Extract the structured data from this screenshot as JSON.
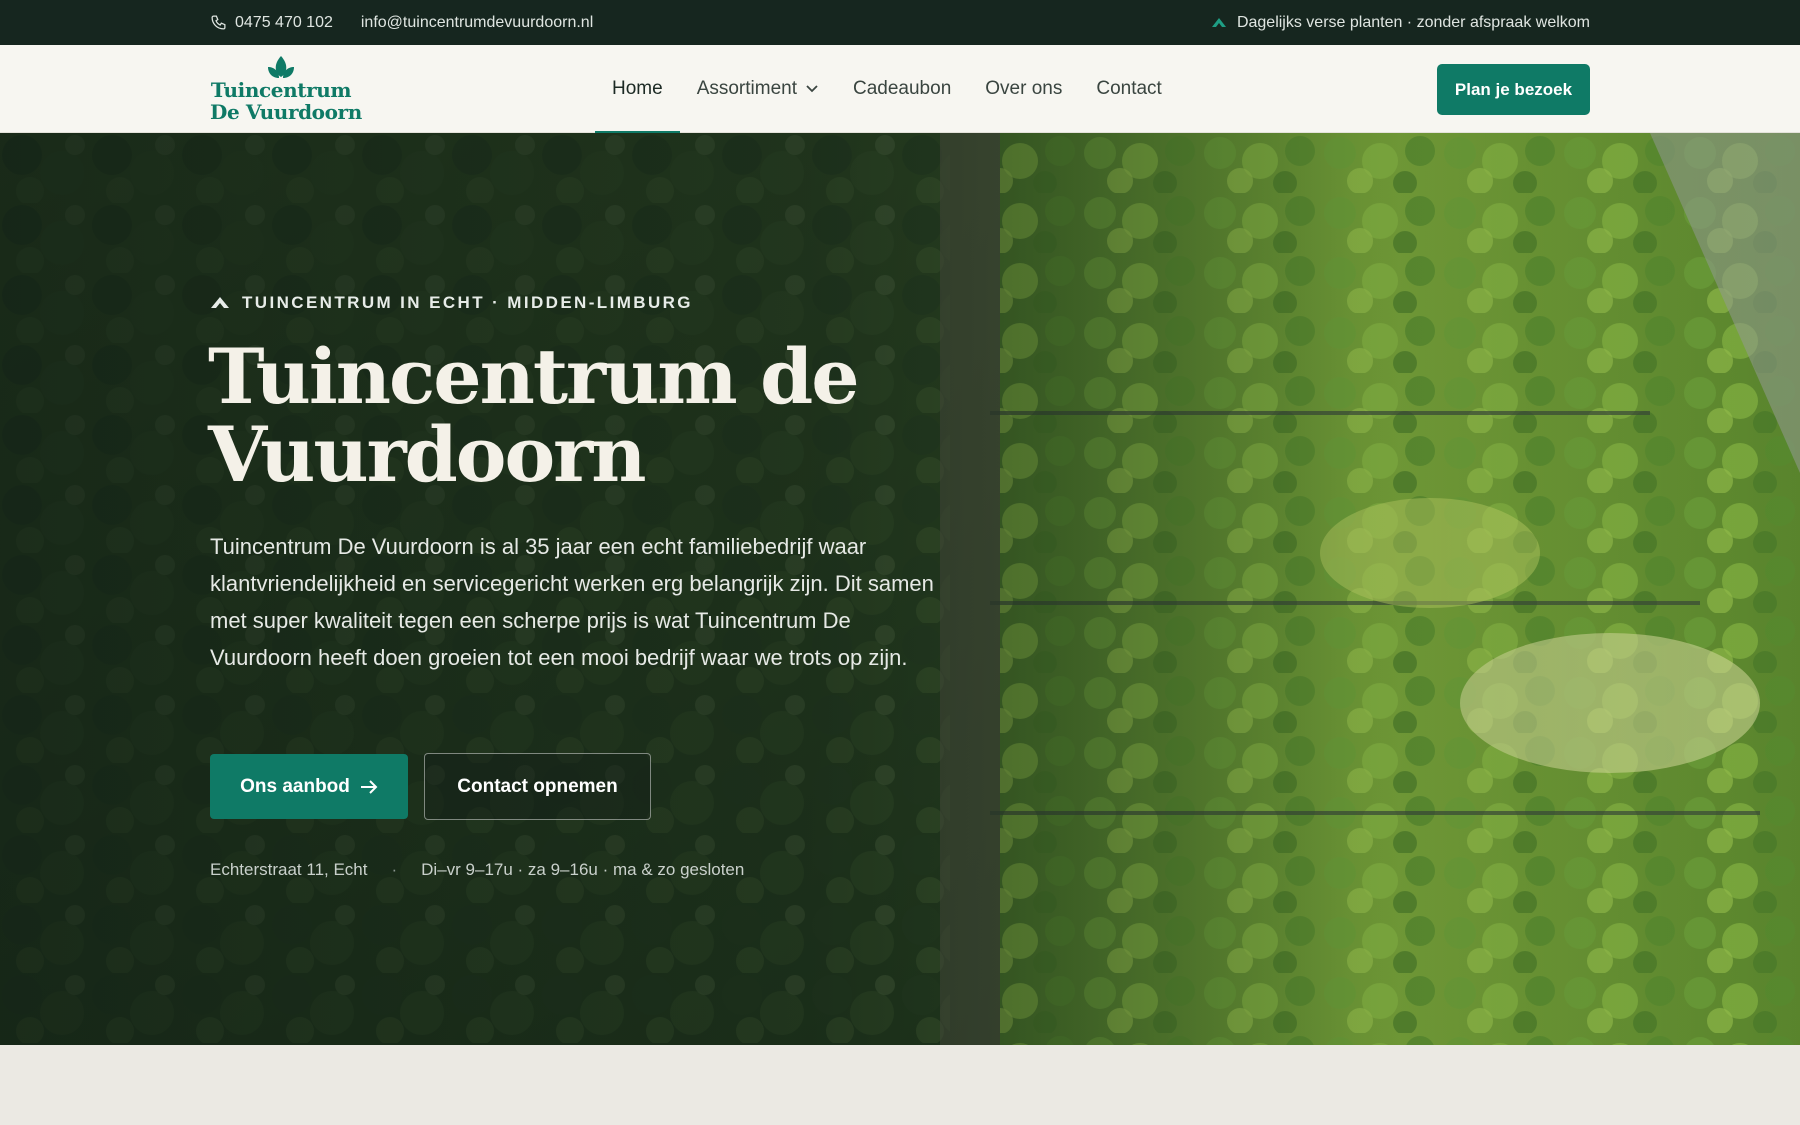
{
  "topbar": {
    "phone": "0475 470 102",
    "email": "info@tuincentrumdevuurdoorn.nl",
    "tagline": "Dagelijks verse planten · zonder afspraak welkom",
    "phone_icon": "phone-icon",
    "tagline_icon": "leaf-icon"
  },
  "logo": {
    "line1": "Tuincentrum",
    "line2": "De Vuurdoorn",
    "icon": "leaf-icon"
  },
  "nav": {
    "items": [
      {
        "label": "Home",
        "active": true
      },
      {
        "label": "Assortiment",
        "dropdown": true
      },
      {
        "label": "Cadeaubon"
      },
      {
        "label": "Over ons"
      },
      {
        "label": "Contact"
      }
    ],
    "cta": "Plan je bezoek"
  },
  "hero": {
    "eyebrow": "TUINCENTRUM IN ECHT · MIDDEN-LIMBURG",
    "title": "Tuincentrum de Vuurdoorn",
    "lead": "Tuincentrum De Vuurdoorn is al 35 jaar een echt familiebedrijf waar klantvriendelijkheid en servicegericht werken erg belangrijk zijn. Dit samen met super kwaliteit tegen een scherpe prijs is wat Tuincentrum De Vuurdoorn heeft doen groeien tot een mooi bedrijf waar we trots op zijn.",
    "primary_button": "Ons aanbod",
    "secondary_button": "Contact opnemen",
    "address": "Echterstraat 11, Echt",
    "hours": "Di–vr 9–17u · za 9–16u · ma & zo gesloten",
    "separator": "·"
  },
  "colors": {
    "brand": "#0f7a66",
    "topbar": "#16261f",
    "header": "#f7f6f1"
  }
}
